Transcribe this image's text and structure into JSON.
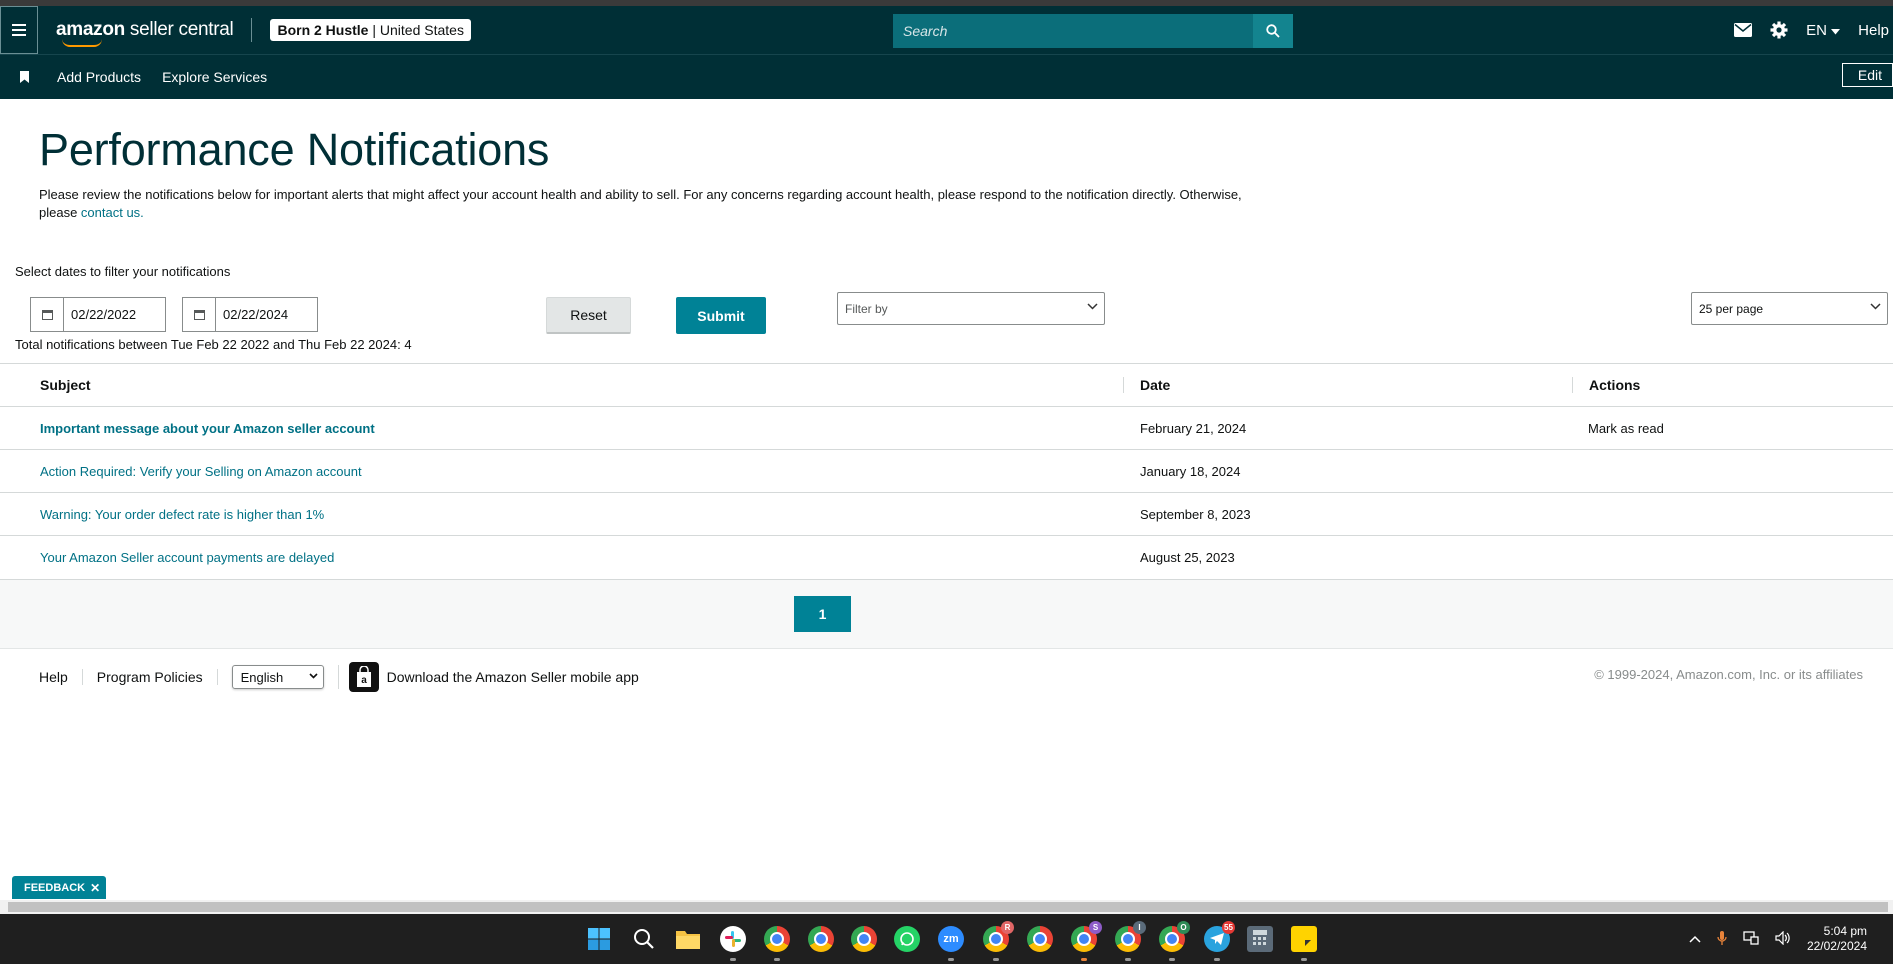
{
  "topbar": {
    "logo_main": "amazon",
    "logo_rest": " seller central",
    "account_name": "Born 2 Hustle",
    "account_region": "United States",
    "search_placeholder": "Search",
    "language": "EN",
    "help": "Help"
  },
  "subbar": {
    "links": [
      "Add Products",
      "Explore Services"
    ],
    "edit": "Edit"
  },
  "page": {
    "title": "Performance Notifications",
    "description": "Please review the notifications below for important alerts that might affect your account health and ability to sell. For any concerns regarding account health, please respond to the notification directly. Otherwise, please ",
    "contact_link": "contact us.",
    "filter_label": "Select dates to filter your notifications",
    "start_date": "02/22/2022",
    "end_date": "02/22/2024",
    "total": "Total notifications between Tue Feb 22 2022 and Thu Feb 22 2024: 4",
    "reset": "Reset",
    "submit": "Submit",
    "filter_placeholder": "Filter by",
    "per_page": "25 per page"
  },
  "table": {
    "headers": [
      "Subject",
      "Date",
      "Actions"
    ],
    "rows": [
      {
        "subject": "Important message about your Amazon seller account",
        "date": "February 21, 2024",
        "action": "Mark as read"
      },
      {
        "subject": "Action Required: Verify your Selling on Amazon account",
        "date": "January 18, 2024",
        "action": ""
      },
      {
        "subject": "Warning: Your order defect rate is higher than 1%",
        "date": "September 8, 2023",
        "action": ""
      },
      {
        "subject": "Your Amazon Seller account payments are delayed",
        "date": "August 25, 2023",
        "action": ""
      }
    ]
  },
  "pagination": {
    "current": "1"
  },
  "footer": {
    "help": "Help",
    "policies": "Program Policies",
    "language": "English",
    "app_text": "Download the Amazon Seller mobile app",
    "copyright": "© 1999-2024, Amazon.com, Inc. or its affiliates"
  },
  "feedback": "FEEDBACK",
  "taskbar": {
    "time": "5:04 pm",
    "date": "22/02/2024",
    "badges": {
      "chrome_r": "R",
      "chrome_s": "S",
      "chrome_i": "I",
      "chrome_o": "O",
      "telegram": "55"
    }
  },
  "colors": {
    "header": "#002f36",
    "accent": "#008296",
    "link": "#007185"
  }
}
